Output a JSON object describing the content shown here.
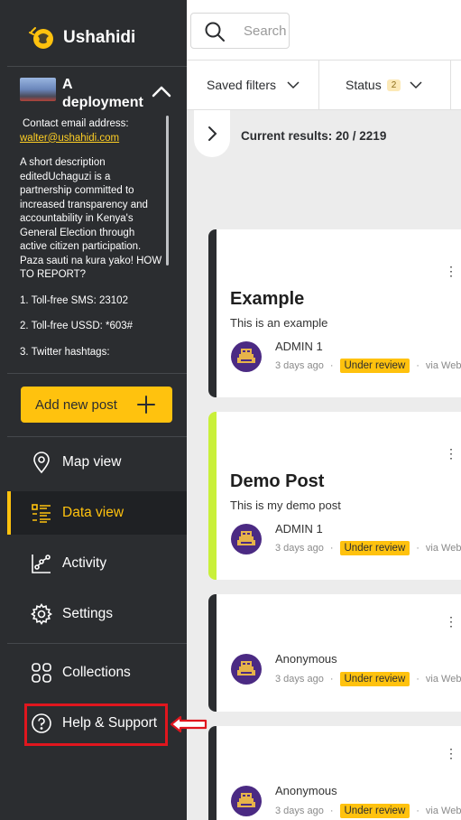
{
  "brand": {
    "name": "Ushahidi"
  },
  "deployment": {
    "title": "A deployment",
    "contact_label": "Contact email address:",
    "email": "walter@ushahidi.com",
    "description": "A short description editedUchaguzi is a partnership committed to increased transparency and accountability in Kenya's General Election through active citizen participation. Paza sauti na kura yako! HOW TO REPORT?",
    "sms": "1. Toll-free SMS: 23102",
    "ussd": "2. Toll-free USSD: *603#",
    "twitter": "3. Twitter hashtags:"
  },
  "sidebar": {
    "add_post": "Add new post",
    "nav": [
      {
        "label": "Map view",
        "icon": "map-pin-icon"
      },
      {
        "label": "Data view",
        "icon": "data-list-icon",
        "active": true
      },
      {
        "label": "Activity",
        "icon": "activity-chart-icon"
      },
      {
        "label": "Settings",
        "icon": "gear-icon"
      },
      {
        "label": "Collections",
        "icon": "collections-grid-icon"
      },
      {
        "label": "Help & Support",
        "icon": "help-circle-icon"
      }
    ]
  },
  "search": {
    "placeholder": "Search"
  },
  "filters": {
    "saved_filters": "Saved filters",
    "status_label": "Status",
    "status_count": "2"
  },
  "results": {
    "text": "Current results: 20 / 2219"
  },
  "posts": [
    {
      "title": "Example",
      "description": "This is an example",
      "author": "ADMIN 1",
      "time": "3 days ago",
      "status": "Under review",
      "source": "via Web",
      "accent": "#2b2d30"
    },
    {
      "title": "Demo Post",
      "description": "This is my demo post",
      "author": "ADMIN 1",
      "time": "3 days ago",
      "status": "Under review",
      "source": "via Web",
      "accent": "#c9f03a"
    },
    {
      "title": "",
      "description": "",
      "author": "Anonymous",
      "time": "3 days ago",
      "status": "Under review",
      "source": "via Web",
      "accent": "#2b2d30"
    },
    {
      "title": "",
      "description": "",
      "author": "Anonymous",
      "time": "3 days ago",
      "status": "Under review",
      "source": "via Web",
      "accent": "#2b2d30"
    }
  ],
  "colors": {
    "sidebar": "#2b2d30",
    "accent": "#ffc20e",
    "highlight": "#e0161e",
    "link": "#ffcf24"
  }
}
